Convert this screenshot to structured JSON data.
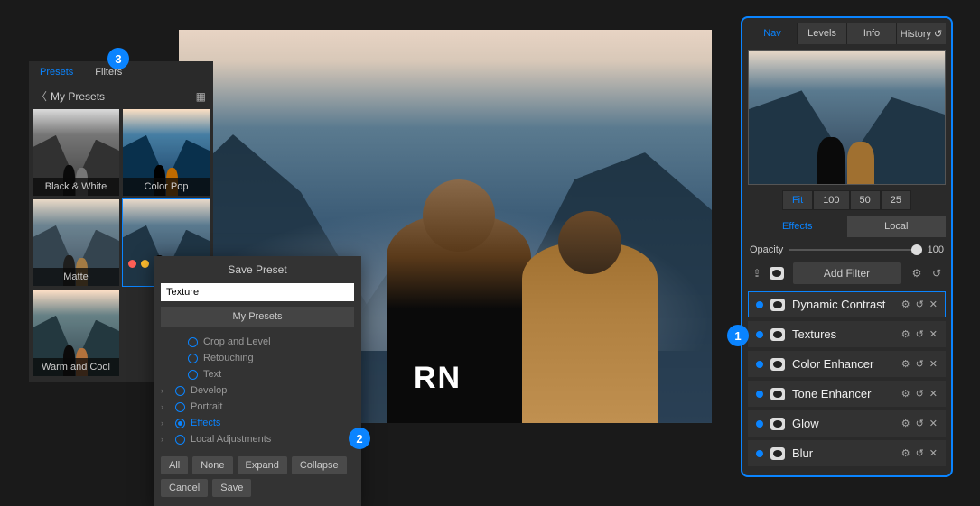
{
  "canvas": {
    "shirt_text": "RN"
  },
  "right": {
    "tabs": {
      "nav": "Nav",
      "levels": "Levels",
      "info": "Info",
      "history": "History"
    },
    "zoom": {
      "fit": "Fit",
      "z100": "100",
      "z50": "50",
      "z25": "25"
    },
    "effects_local": {
      "effects": "Effects",
      "local": "Local"
    },
    "opacity": {
      "label": "Opacity",
      "value": "100"
    },
    "add_filter": "Add Filter",
    "filters": [
      {
        "name": "Dynamic Contrast",
        "selected": true
      },
      {
        "name": "Textures",
        "selected": false
      },
      {
        "name": "Color Enhancer",
        "selected": false
      },
      {
        "name": "Tone Enhancer",
        "selected": false
      },
      {
        "name": "Glow",
        "selected": false
      },
      {
        "name": "Blur",
        "selected": false
      }
    ]
  },
  "left": {
    "tabs": {
      "presets": "Presets",
      "filters": "Filters"
    },
    "header": "My Presets",
    "presets": [
      {
        "label": "Black & White"
      },
      {
        "label": "Color Pop"
      },
      {
        "label": "Matte"
      },
      {
        "label": "",
        "selected": true
      },
      {
        "label": "Warm and Cool"
      }
    ]
  },
  "dialog": {
    "title": "Save Preset",
    "input_value": "Texture",
    "folder": "My Presets",
    "tree": {
      "crop": "Crop and Level",
      "retouch": "Retouching",
      "text": "Text",
      "develop": "Develop",
      "portrait": "Portrait",
      "effects": "Effects",
      "local": "Local Adjustments"
    },
    "buttons": {
      "all": "All",
      "none": "None",
      "expand": "Expand",
      "collapse": "Collapse",
      "cancel": "Cancel",
      "save": "Save"
    }
  },
  "badges": {
    "b1": "1",
    "b2": "2",
    "b3": "3"
  }
}
